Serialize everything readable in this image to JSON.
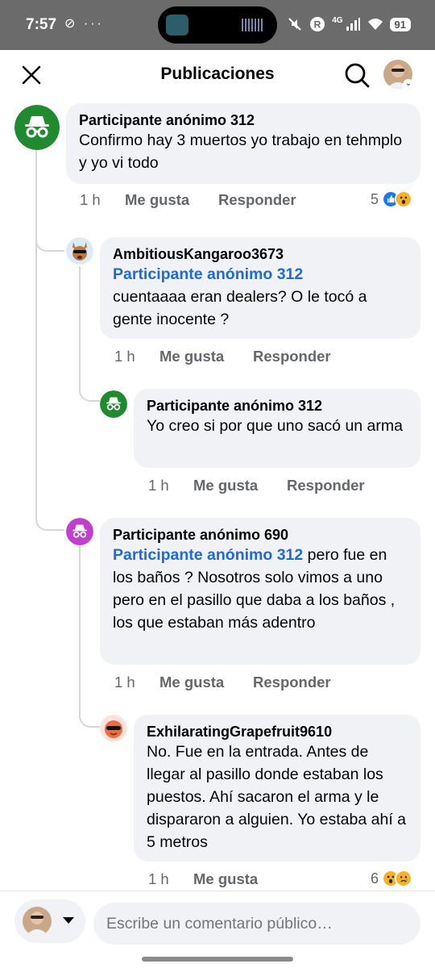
{
  "status_bar": {
    "time": "7:57",
    "left_icons": "⊘ ···",
    "network": "4G",
    "battery": "91"
  },
  "header": {
    "title": "Publicaciones"
  },
  "comments": [
    {
      "author": "Participante anónimo 312",
      "mention": "",
      "text": "Confirmo hay 3 muertos yo trabajo en tehmplo y yo vi todo",
      "time": "1 h",
      "like": "Me gusta",
      "reply": "Responder",
      "reaction_count": "5",
      "reactions": [
        "like-icon",
        "wow-icon"
      ]
    },
    {
      "author": "AmbitiousKangaroo3673",
      "mention": "Participante anónimo 312",
      "text": "cuentaaaa eran dealers? O le tocó a gente inocente ?",
      "time": "1 h",
      "like": "Me gusta",
      "reply": "Responder"
    },
    {
      "author": "Participante anónimo 312",
      "mention": "",
      "text": "Yo creo si por que uno sacó un arma",
      "time": "1 h",
      "like": "Me gusta",
      "reply": "Responder"
    },
    {
      "author": "Participante anónimo 690",
      "mention": "Participante anónimo 312",
      "text": " pero fue en los baños ? Nosotros solo vimos a uno pero en el pasillo que daba a los baños , los que estaban más adentro",
      "time": "1 h",
      "like": "Me gusta",
      "reply": "Responder"
    },
    {
      "author": "ExhilaratingGrapefruit9610",
      "mention": "",
      "text": "No. Fue en la entrada. Antes de llegar al pasillo donde estaban los puestos. Ahí sacaron el arma y le dispararon a alguien. Yo estaba ahí a 5 metros",
      "time": "1 h",
      "like": "Me gusta",
      "reply": "Responder",
      "reaction_count": "6",
      "reactions": [
        "wow-icon",
        "sad-icon"
      ]
    }
  ],
  "composer": {
    "placeholder": "Escribe un comentario público…"
  },
  "colors": {
    "anon_green": "#1f8a2e",
    "anon_purple": "#c13ecf",
    "link_blue": "#1e6bd6",
    "bubble": "#f0f2f5"
  }
}
